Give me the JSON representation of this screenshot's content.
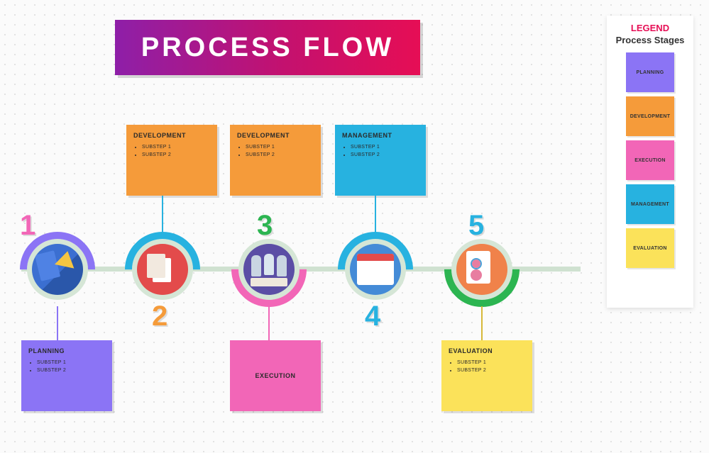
{
  "title": "PROCESS FLOW",
  "legend": {
    "heading": "LEGEND",
    "sub": "Process Stages",
    "items": [
      {
        "label": "PLANNING",
        "color": "purple"
      },
      {
        "label": "DEVELOPMENT",
        "color": "orange"
      },
      {
        "label": "EXECUTION",
        "color": "pink"
      },
      {
        "label": "MANAGEMENT",
        "color": "blue"
      },
      {
        "label": "EVALUATION",
        "color": "yellow"
      }
    ]
  },
  "stages": [
    {
      "num": "1",
      "name": "PLANNING",
      "color": "purple",
      "substeps": [
        "SUBSTEP 1",
        "SUBSTEP 2"
      ],
      "icon": "plan"
    },
    {
      "num": "2",
      "name": "DEVELOPMENT",
      "color": "orange",
      "substeps": [
        "SUBSTEP 1",
        "SUBSTEP 2"
      ],
      "icon": "docs"
    },
    {
      "num": "3",
      "name": "EXECUTION",
      "color": "pink",
      "substeps": [],
      "icon": "chess"
    },
    {
      "num": "4",
      "name": "MANAGEMENT",
      "color": "blue",
      "substeps": [
        "SUBSTEP 1",
        "SUBSTEP 2"
      ],
      "icon": "web"
    },
    {
      "num": "5",
      "name": "EVALUATION",
      "color": "yellow",
      "substeps": [
        "SUBSTEP 1",
        "SUBSTEP 2"
      ],
      "icon": "eval"
    }
  ],
  "extra_cards": [
    {
      "name": "DEVELOPMENT",
      "color": "orange",
      "substeps": [
        "SUBSTEP 1",
        "SUBSTEP 2"
      ]
    }
  ]
}
